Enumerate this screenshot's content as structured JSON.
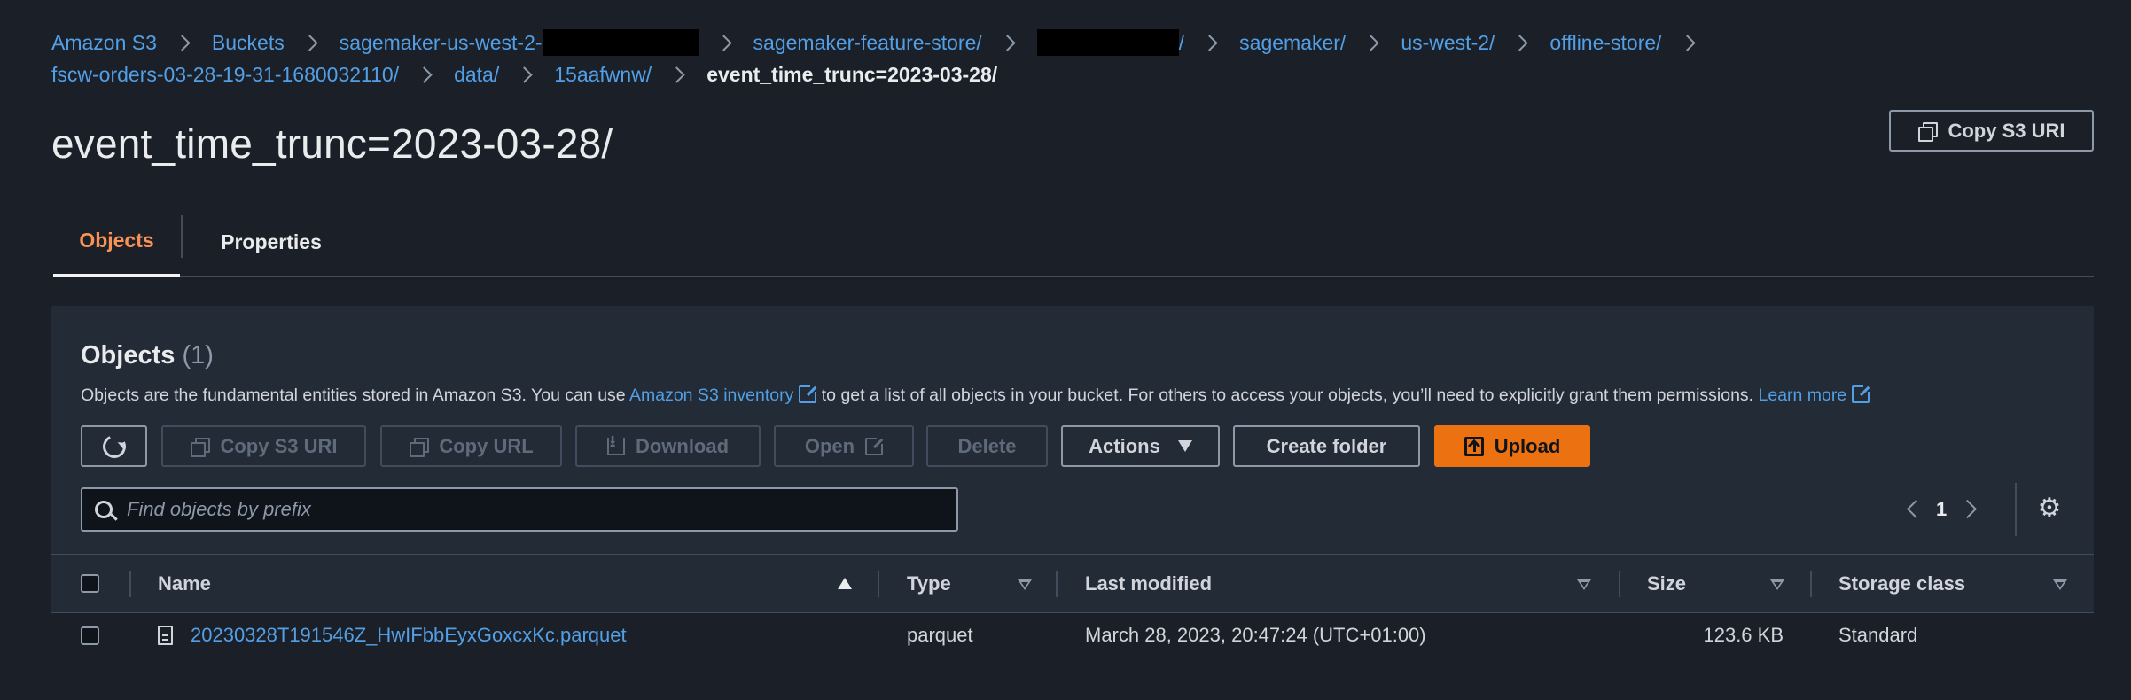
{
  "breadcrumb": {
    "items": [
      {
        "label": "Amazon S3"
      },
      {
        "label": "Buckets"
      },
      {
        "label": "sagemaker-us-west-2-",
        "redacted_after": true
      },
      {
        "label": "sagemaker-feature-store/"
      },
      {
        "label": "/",
        "redacted_before": true
      },
      {
        "label": "sagemaker/"
      },
      {
        "label": "us-west-2/"
      },
      {
        "label": "offline-store/"
      },
      {
        "label": "fscw-orders-03-28-19-31-1680032110/"
      },
      {
        "label": "data/"
      },
      {
        "label": "15aafwnw/"
      }
    ],
    "current": "event_time_trunc=2023-03-28/"
  },
  "page_title": "event_time_trunc=2023-03-28/",
  "header_actions": {
    "copy_s3_uri": "Copy S3 URI"
  },
  "tabs": [
    {
      "label": "Objects",
      "active": true
    },
    {
      "label": "Properties",
      "active": false
    }
  ],
  "objects_section": {
    "title": "Objects",
    "count": "(1)",
    "description_prefix": "Objects are the fundamental entities stored in Amazon S3. You can use ",
    "inventory_link": "Amazon S3 inventory",
    "description_middle": " to get a list of all objects in your bucket. For others to access your objects, you’ll need to explicitly grant them permissions. ",
    "learn_more": "Learn more"
  },
  "toolbar": {
    "copy_s3_uri": "Copy S3 URI",
    "copy_url": "Copy URL",
    "download": "Download",
    "open": "Open",
    "delete": "Delete",
    "actions": "Actions",
    "create_folder": "Create folder",
    "upload": "Upload"
  },
  "search": {
    "placeholder": "Find objects by prefix",
    "value": ""
  },
  "pagination": {
    "current_page": "1"
  },
  "table": {
    "columns": [
      "Name",
      "Type",
      "Last modified",
      "Size",
      "Storage class"
    ],
    "rows": [
      {
        "name": "20230328T191546Z_HwIFbbEyxGoxcxKc.parquet",
        "type": "parquet",
        "last_modified": "March 28, 2023, 20:47:24 (UTC+01:00)",
        "size": "123.6 KB",
        "storage_class": "Standard"
      }
    ]
  },
  "colors": {
    "background": "#1b2028",
    "panel": "#232b37",
    "link": "#539fe5",
    "accent_orange": "#ec7211",
    "active_tab": "#f89256"
  }
}
